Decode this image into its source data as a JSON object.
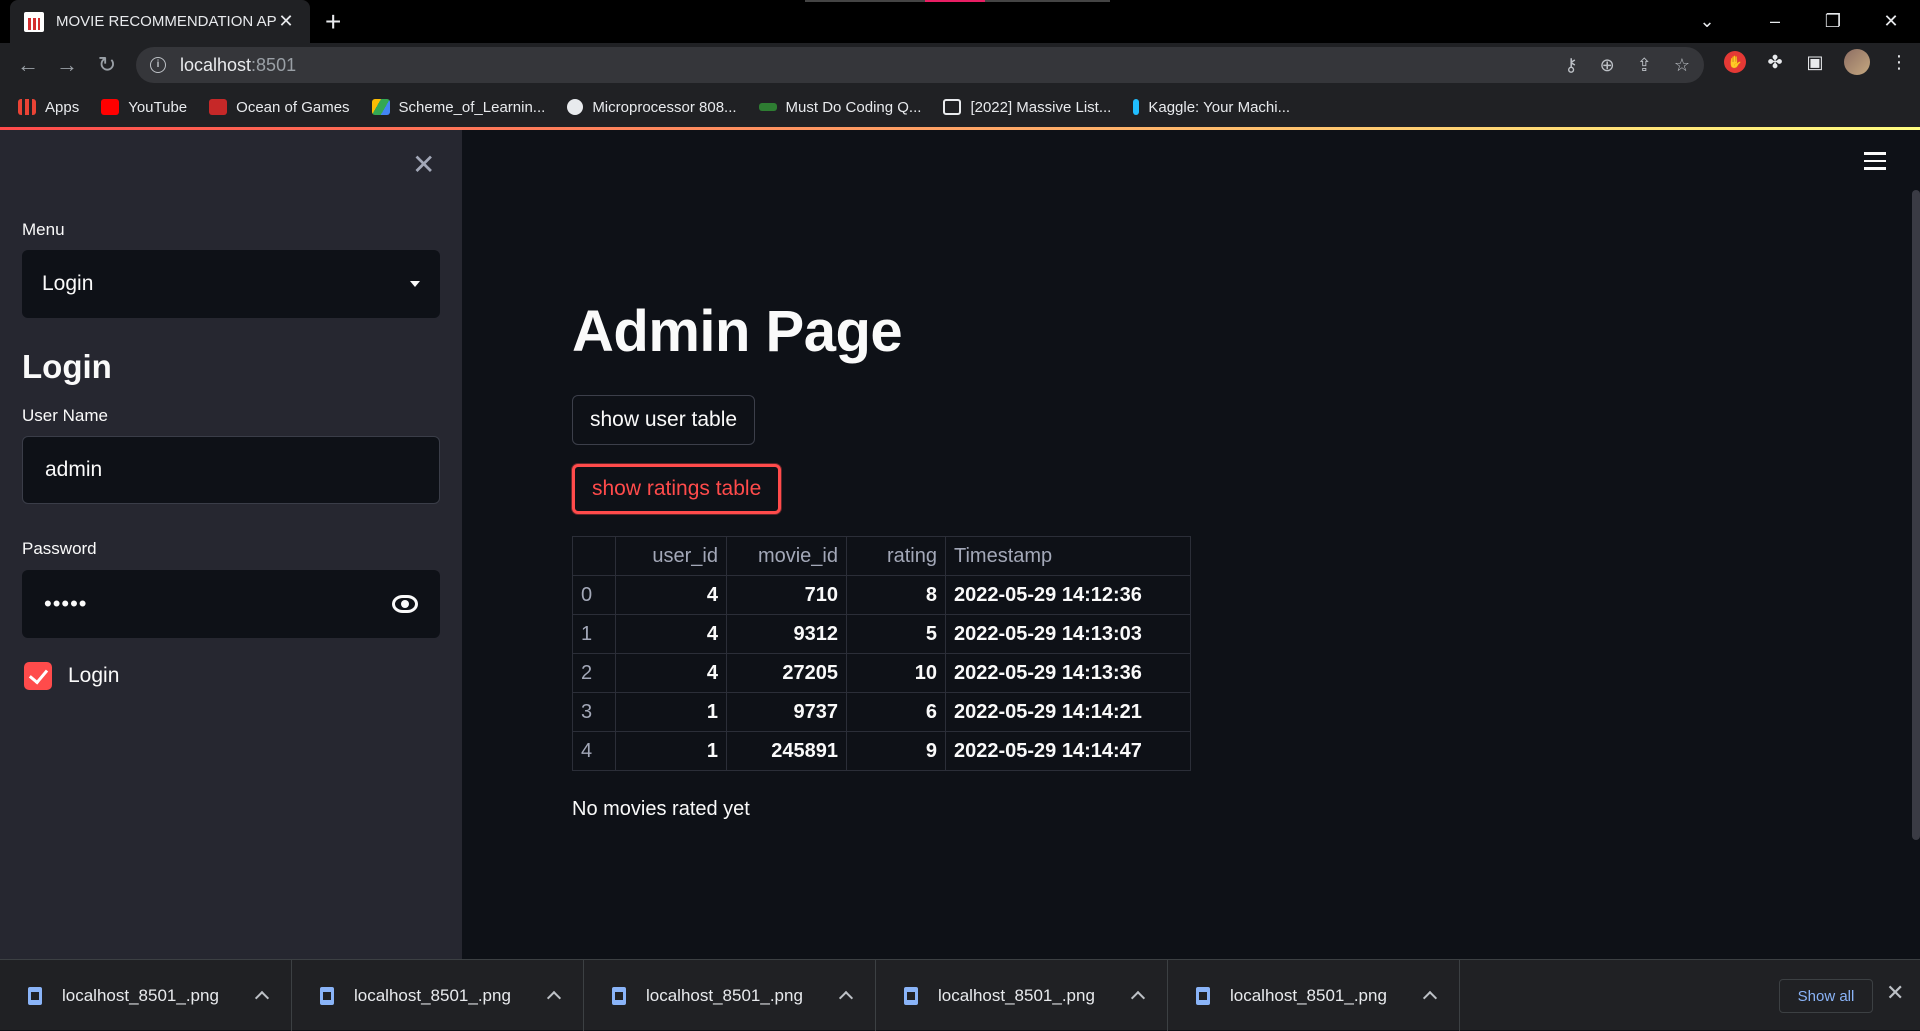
{
  "browser": {
    "tab_title": "MOVIE RECOMMENDATION APP",
    "url_host": "localhost",
    "url_port": ":8501",
    "bookmarks": [
      {
        "label": "Apps",
        "color": "#ea4335"
      },
      {
        "label": "YouTube",
        "color": "#ff0000"
      },
      {
        "label": "Ocean of Games",
        "color": "#c62828"
      },
      {
        "label": "Scheme_of_Learnin...",
        "color": "#fbbc04"
      },
      {
        "label": "Microprocessor 808...",
        "color": "#e8eaed"
      },
      {
        "label": "Must Do Coding Q...",
        "color": "#2e7d32"
      },
      {
        "label": "[2022] Massive List...",
        "color": "#8ab4f8"
      },
      {
        "label": "Kaggle: Your Machi...",
        "color": "#20beff"
      }
    ]
  },
  "sidebar": {
    "menu_label": "Menu",
    "menu_selected": "Login",
    "heading": "Login",
    "username_label": "User Name",
    "username_value": "admin",
    "password_label": "Password",
    "password_masked": "•••••",
    "checkbox_label": "Login",
    "checkbox_checked": true
  },
  "main": {
    "title": "Admin Page",
    "btn_user_table": "show user table",
    "btn_ratings_table": "show ratings table",
    "table": {
      "columns": [
        "",
        "user_id",
        "movie_id",
        "rating",
        "Timestamp"
      ],
      "rows": [
        [
          "0",
          "4",
          "710",
          "8",
          "2022-05-29 14:12:36"
        ],
        [
          "1",
          "4",
          "9312",
          "5",
          "2022-05-29 14:13:03"
        ],
        [
          "2",
          "4",
          "27205",
          "10",
          "2022-05-29 14:13:36"
        ],
        [
          "3",
          "1",
          "9737",
          "6",
          "2022-05-29 14:14:21"
        ],
        [
          "4",
          "1",
          "245891",
          "9",
          "2022-05-29 14:14:47"
        ]
      ]
    },
    "message": "No movies rated yet"
  },
  "downloads": {
    "files": [
      "localhost_8501_.png",
      "localhost_8501_.png",
      "localhost_8501_.png",
      "localhost_8501_.png",
      "localhost_8501_.png"
    ],
    "show_all": "Show all"
  },
  "colors": {
    "accent": "#ff4b4b",
    "app_bg": "#0e1117",
    "sidebar_bg": "#262730"
  }
}
